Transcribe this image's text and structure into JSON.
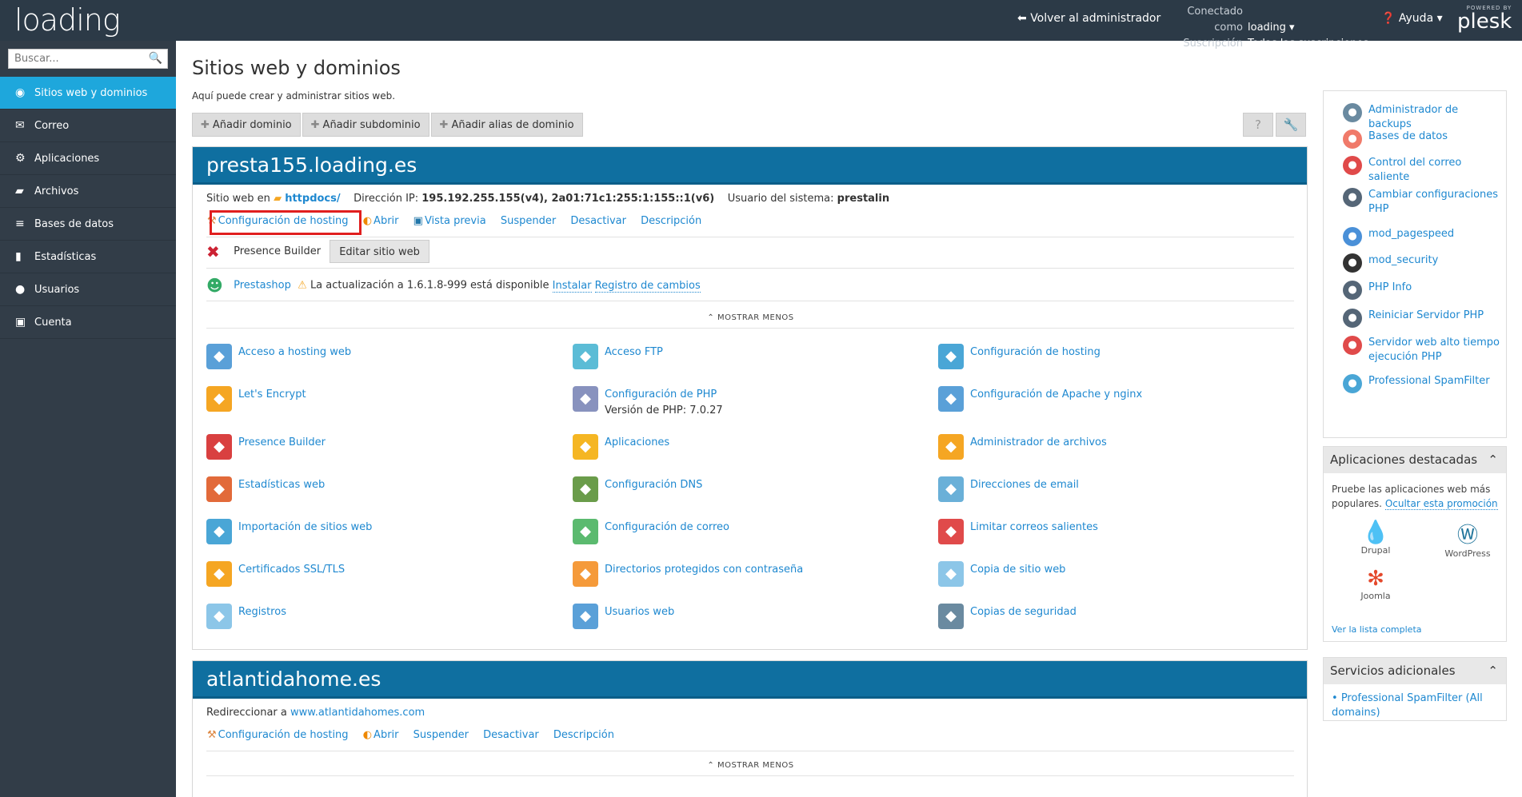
{
  "topbar": {
    "logo": "loading",
    "back_label": "Volver al administrador",
    "connected_label": "Conectado como",
    "user": "loading ▾",
    "subscription_label": "Suscripción",
    "subscription_value": "Todas las suscripciones ▾",
    "help_label": "Ayuda ▾",
    "powered_by": "POWERED BY",
    "plesk": "plesk"
  },
  "search": {
    "placeholder": "Buscar..."
  },
  "nav": [
    {
      "label": "Sitios web y dominios",
      "icon": "globe-icon"
    },
    {
      "label": "Correo",
      "icon": "mail-icon"
    },
    {
      "label": "Aplicaciones",
      "icon": "gear-icon"
    },
    {
      "label": "Archivos",
      "icon": "folder-icon"
    },
    {
      "label": "Bases de datos",
      "icon": "database-icon"
    },
    {
      "label": "Estadísticas",
      "icon": "stats-icon"
    },
    {
      "label": "Usuarios",
      "icon": "user-icon"
    },
    {
      "label": "Cuenta",
      "icon": "account-icon"
    }
  ],
  "main": {
    "title": "Sitios web y dominios",
    "desc": "Aquí puede crear y administrar sitios web.",
    "toolbar": [
      "Añadir dominio",
      "Añadir subdominio",
      "Añadir alias de dominio"
    ],
    "help_btn": "?",
    "tools_btn": "🔧"
  },
  "domain1": {
    "name": "presta155.loading.es",
    "site_label": "Sitio web en",
    "docroot": "httpdocs/",
    "ip_label": "Dirección IP:",
    "ip_value": "195.192.255.155(v4), 2a01:71c1:255:1:155::1(v6)",
    "sysuser_label": "Usuario del sistema:",
    "sysuser_value": "prestalin",
    "links": [
      "Configuración de hosting",
      "Abrir",
      "Vista previa",
      "Suspender",
      "Desactivar",
      "Descripción"
    ],
    "pb_label": "Presence Builder",
    "pb_edit": "Editar sitio web",
    "app_name": "Prestashop",
    "app_update": "La actualización a 1.6.1.8-999 está disponible",
    "app_install": "Instalar",
    "app_changelog": "Registro de cambios",
    "show_less": "⌃ MOSTRAR MENOS",
    "tiles": [
      {
        "label": "Acceso a hosting web",
        "icon": "globe-flag-icon",
        "color": "#5aa0d8"
      },
      {
        "label": "Acceso FTP",
        "icon": "ftp-icon",
        "color": "#5bbcd6"
      },
      {
        "label": "Configuración de hosting",
        "icon": "hosting-config-icon",
        "color": "#4aa6d6"
      },
      {
        "label": "Let's Encrypt",
        "icon": "lets-encrypt-icon",
        "color": "#f5a623"
      },
      {
        "label": "Configuración de PHP",
        "icon": "php-icon",
        "color": "#8892be",
        "sub": "Versión de PHP: 7.0.27"
      },
      {
        "label": "Configuración de Apache y nginx",
        "icon": "apache-icon",
        "color": "#5aa0d8"
      },
      {
        "label": "Presence Builder",
        "icon": "presence-builder-icon",
        "color": "#d94040"
      },
      {
        "label": "Aplicaciones",
        "icon": "applications-icon",
        "color": "#f5b623"
      },
      {
        "label": "Administrador de archivos",
        "icon": "file-manager-icon",
        "color": "#f5a623"
      },
      {
        "label": "Estadísticas web",
        "icon": "web-stats-icon",
        "color": "#e26a3a"
      },
      {
        "label": "Configuración DNS",
        "icon": "dns-icon",
        "color": "#6a9c4a"
      },
      {
        "label": "Direcciones de email",
        "icon": "email-icon",
        "color": "#6ab0d8"
      },
      {
        "label": "Importación de sitios web",
        "icon": "import-icon",
        "color": "#4aa6d6"
      },
      {
        "label": "Configuración de correo",
        "icon": "mail-config-icon",
        "color": "#5bba6f"
      },
      {
        "label": "Limitar correos salientes",
        "icon": "limit-mail-icon",
        "color": "#e04a4a"
      },
      {
        "label": "Certificados SSL/TLS",
        "icon": "ssl-icon",
        "color": "#f5a623"
      },
      {
        "label": "Directorios protegidos con contraseña",
        "icon": "protected-dir-icon",
        "color": "#f59a3a"
      },
      {
        "label": "Copia de sitio web",
        "icon": "copy-site-icon",
        "color": "#8cc6e8"
      },
      {
        "label": "Registros",
        "icon": "logs-icon",
        "color": "#8cc6e8"
      },
      {
        "label": "Usuarios web",
        "icon": "web-users-icon",
        "color": "#5aa0d8"
      },
      {
        "label": "Copias de seguridad",
        "icon": "backup-icon",
        "color": "#6a8aa0"
      }
    ]
  },
  "domain2": {
    "name": "atlantidahome.es",
    "redirect_label": "Redireccionar a",
    "redirect_url": "www.atlantidahomes.com",
    "links": [
      "Configuración de hosting",
      "Abrir",
      "Suspender",
      "Desactivar",
      "Descripción"
    ],
    "show_less": "⌃ MOSTRAR MENOS"
  },
  "rpanel": [
    {
      "label": "Administrador de backups",
      "icon": "backup-manager-icon",
      "color": "#6a8aa0"
    },
    {
      "label": "Bases de datos",
      "icon": "databases-icon",
      "color": "#f07a6a"
    },
    {
      "label": "Control del correo saliente",
      "icon": "outgoing-mail-icon",
      "color": "#e04a4a"
    },
    {
      "label": "Cambiar configuraciones PHP",
      "icon": "php-settings-icon",
      "color": "#556677"
    },
    {
      "label": "mod_pagespeed",
      "icon": "pagespeed-icon",
      "color": "#4a90d8"
    },
    {
      "label": "mod_security",
      "icon": "mod-security-icon",
      "color": "#333333"
    },
    {
      "label": "PHP Info",
      "icon": "php-info-icon",
      "color": "#556677"
    },
    {
      "label": "Reiniciar Servidor PHP",
      "icon": "restart-php-icon",
      "color": "#556677"
    },
    {
      "label": "Servidor web alto tiempo ejecución PHP",
      "icon": "timer-icon",
      "color": "#e04a4a"
    },
    {
      "label": "Professional SpamFilter",
      "icon": "spamfilter-icon",
      "color": "#4aa6d6"
    }
  ],
  "featured": {
    "title": "Aplicaciones destacadas",
    "desc": "Pruebe las aplicaciones web más populares.",
    "hide": "Ocultar esta promoción",
    "apps": [
      {
        "label": "Drupal",
        "icon": "drupal-icon"
      },
      {
        "label": "WordPress",
        "icon": "wordpress-icon"
      },
      {
        "label": "Joomla",
        "icon": "joomla-icon"
      }
    ],
    "all": "Ver la lista completa"
  },
  "services": {
    "title": "Servicios adicionales",
    "item": "Professional SpamFilter (All domains)"
  }
}
